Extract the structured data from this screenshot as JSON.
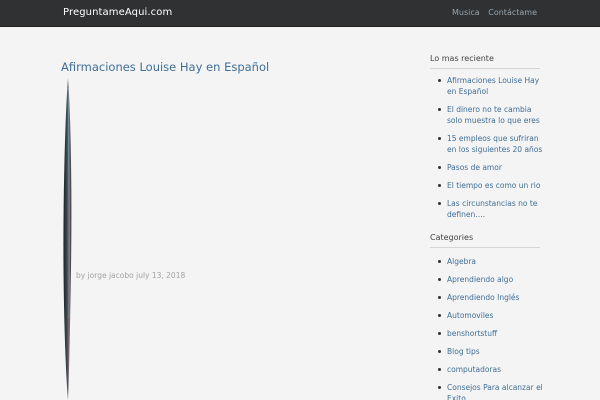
{
  "header": {
    "site_title": "PreguntameAqui.com",
    "nav": [
      "Musica",
      "Contáctame"
    ]
  },
  "post": {
    "title": "Afirmaciones Louise Hay en Español",
    "byline_prefix": "by",
    "author": "jorge jacobo",
    "date": "july 13, 2018"
  },
  "sidebar": {
    "recent": {
      "title": "Lo mas reciente",
      "items": [
        "Afirmaciones Louise Hay en Español",
        "El dinero no te cambia solo muestra lo que eres",
        "15 empleos que sufriran en los siguientes 20 años",
        "Pasos de amor",
        "El tiempo es como un rio",
        "Las circunstancias no te definen…."
      ]
    },
    "categories": {
      "title": "Categories",
      "items": [
        "Algebra",
        "Aprendiendo algo",
        "Aprendiendo Inglés",
        "Automoviles",
        "benshortstuff",
        "Blog tips",
        "computadoras",
        "Consejos Para alcanzar el Exito"
      ]
    }
  },
  "colors": {
    "topbar": "#2f3133",
    "link": "#3f6e98",
    "background": "#f4f4f4"
  }
}
